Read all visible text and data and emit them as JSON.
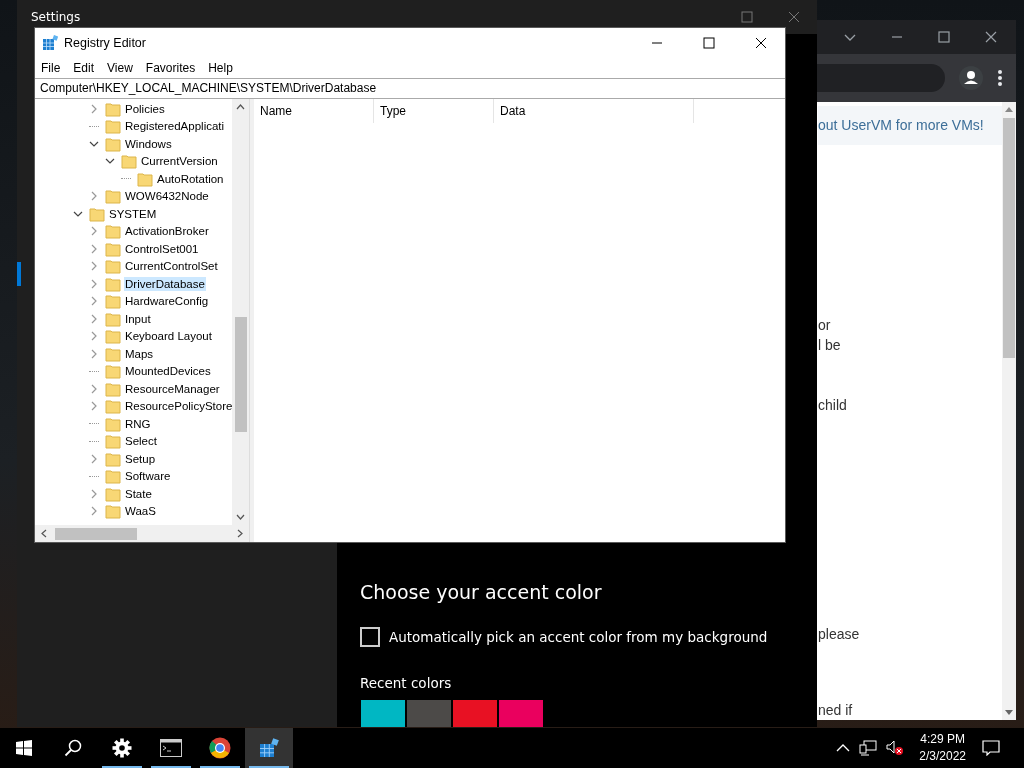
{
  "settings": {
    "title": "Settings",
    "accent": {
      "heading": "Choose your accent color",
      "auto_pick": {
        "label": "Automatically pick an accent color from my background",
        "checked": false
      },
      "recent_label": "Recent colors",
      "recent_colors": [
        {
          "color": "#00b7c3"
        },
        {
          "color": "#4c4a48"
        },
        {
          "color": "#e81123"
        },
        {
          "color": "#ea005e"
        }
      ]
    }
  },
  "browser": {
    "banner": "out UserVM for more VMs!",
    "text_fragments": [
      "or",
      "l be",
      "child",
      "please",
      "ned if"
    ]
  },
  "registry_editor": {
    "title": "Registry Editor",
    "menu": [
      "File",
      "Edit",
      "View",
      "Favorites",
      "Help"
    ],
    "address": "Computer\\HKEY_LOCAL_MACHINE\\SYSTEM\\DriverDatabase",
    "tree": {
      "continued_children": [
        {
          "label": "Policies",
          "expandable": true,
          "expanded": false,
          "selected": false
        },
        {
          "label": "RegisteredApplicati",
          "expandable": false,
          "selected": false
        },
        {
          "label": "Windows",
          "expandable": true,
          "expanded": true,
          "selected": false,
          "children": [
            {
              "label": "CurrentVersion",
              "expandable": true,
              "expanded": true,
              "selected": false,
              "children": [
                {
                  "label": "AutoRotation",
                  "expandable": false,
                  "selected": false
                }
              ]
            }
          ]
        },
        {
          "label": "WOW6432Node",
          "expandable": true,
          "expanded": false,
          "selected": false
        }
      ],
      "items": [
        {
          "label": "SYSTEM",
          "expandable": true,
          "expanded": true,
          "selected": false,
          "children": [
            {
              "label": "ActivationBroker",
              "expandable": true,
              "expanded": false,
              "selected": false
            },
            {
              "label": "ControlSet001",
              "expandable": true,
              "expanded": false,
              "selected": false
            },
            {
              "label": "CurrentControlSet",
              "expandable": true,
              "expanded": false,
              "selected": false
            },
            {
              "label": "DriverDatabase",
              "expandable": true,
              "expanded": false,
              "selected": true
            },
            {
              "label": "HardwareConfig",
              "expandable": true,
              "expanded": false,
              "selected": false
            },
            {
              "label": "Input",
              "expandable": true,
              "expanded": false,
              "selected": false
            },
            {
              "label": "Keyboard Layout",
              "expandable": true,
              "expanded": false,
              "selected": false
            },
            {
              "label": "Maps",
              "expandable": true,
              "expanded": false,
              "selected": false
            },
            {
              "label": "MountedDevices",
              "expandable": false,
              "selected": false
            },
            {
              "label": "ResourceManager",
              "expandable": true,
              "expanded": false,
              "selected": false
            },
            {
              "label": "ResourcePolicyStore",
              "expandable": true,
              "expanded": false,
              "selected": false
            },
            {
              "label": "RNG",
              "expandable": false,
              "selected": false
            },
            {
              "label": "Select",
              "expandable": false,
              "selected": false
            },
            {
              "label": "Setup",
              "expandable": true,
              "expanded": false,
              "selected": false
            },
            {
              "label": "Software",
              "expandable": false,
              "selected": false
            },
            {
              "label": "State",
              "expandable": true,
              "expanded": false,
              "selected": false
            },
            {
              "label": "WaaS",
              "expandable": true,
              "expanded": false,
              "selected": false
            }
          ]
        }
      ]
    },
    "columns": [
      "Name",
      "Type",
      "Data"
    ]
  },
  "taskbar": {
    "items": [
      {
        "kind": "start",
        "running": false,
        "active": false
      },
      {
        "kind": "search",
        "running": false,
        "active": false
      },
      {
        "kind": "settings",
        "running": true,
        "active": false
      },
      {
        "kind": "terminal",
        "running": true,
        "active": false
      },
      {
        "kind": "browser",
        "running": true,
        "active": false
      },
      {
        "kind": "registry",
        "running": true,
        "active": true
      }
    ],
    "time": "4:29 PM",
    "date": "2/3/2022"
  }
}
